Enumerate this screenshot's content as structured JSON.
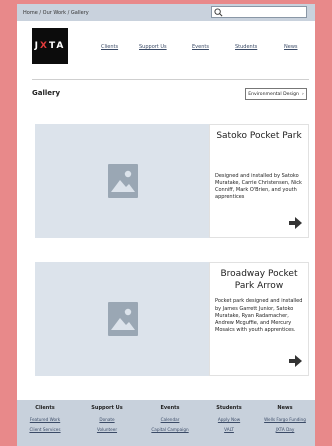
{
  "breadcrumb": "Home / Our Work / Gallery",
  "search": {
    "placeholder": ""
  },
  "logo": {
    "part1": "J",
    "accent": "X",
    "part2": "TA"
  },
  "nav": {
    "items": [
      {
        "label": "Clients"
      },
      {
        "label": "Support Us"
      },
      {
        "label": "Events"
      },
      {
        "label": "Students"
      },
      {
        "label": "News"
      }
    ]
  },
  "gallery": {
    "title": "Gallery",
    "filter_label": "Environmental Design"
  },
  "cards": [
    {
      "title": "Satoko Pocket Park",
      "description": "Designed and installed by Satoko Muratake, Carrie Christensen, Nick Conniff, Mark O'Brien, and youth apprentices"
    },
    {
      "title": "Broadway Pocket Park Arrow",
      "description": "Pocket park designed and installed by James Garrett Junior, Satoko Muratake, Ryan Radamacher, Andrew Mcguffie, and Mercury Mosaics with youth apprentices."
    }
  ],
  "footer": {
    "columns": [
      {
        "head": "Clients",
        "links": [
          "Featured Work",
          "Client Services"
        ]
      },
      {
        "head": "Support Us",
        "links": [
          "Donate",
          "Volunteer"
        ]
      },
      {
        "head": "Events",
        "links": [
          "Calendar",
          "Capital Campaign"
        ]
      },
      {
        "head": "Students",
        "links": [
          "Apply Now",
          "VALT"
        ]
      },
      {
        "head": "News",
        "links": [
          "Wells Fargo Funding",
          "JXTA Day"
        ]
      }
    ]
  },
  "colors": {
    "background": "#e8898a",
    "topbar": "#c9d2dd",
    "card_image_bg": "#dce3eb",
    "footer": "#c8d1dc",
    "logo_bg": "#0c0c0c",
    "logo_accent": "#e23b3b"
  }
}
